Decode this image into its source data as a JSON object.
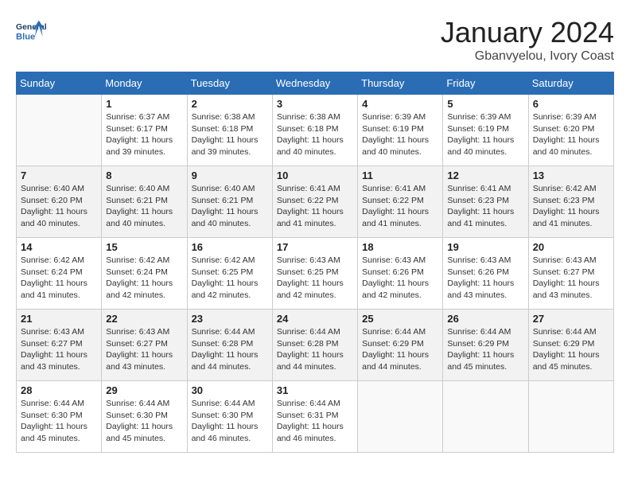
{
  "header": {
    "logo_line1": "General",
    "logo_line2": "Blue",
    "month": "January 2024",
    "location": "Gbanvyelou, Ivory Coast"
  },
  "days_of_week": [
    "Sunday",
    "Monday",
    "Tuesday",
    "Wednesday",
    "Thursday",
    "Friday",
    "Saturday"
  ],
  "weeks": [
    [
      {
        "day": "",
        "info": ""
      },
      {
        "day": "1",
        "info": "Sunrise: 6:37 AM\nSunset: 6:17 PM\nDaylight: 11 hours\nand 39 minutes."
      },
      {
        "day": "2",
        "info": "Sunrise: 6:38 AM\nSunset: 6:18 PM\nDaylight: 11 hours\nand 39 minutes."
      },
      {
        "day": "3",
        "info": "Sunrise: 6:38 AM\nSunset: 6:18 PM\nDaylight: 11 hours\nand 40 minutes."
      },
      {
        "day": "4",
        "info": "Sunrise: 6:39 AM\nSunset: 6:19 PM\nDaylight: 11 hours\nand 40 minutes."
      },
      {
        "day": "5",
        "info": "Sunrise: 6:39 AM\nSunset: 6:19 PM\nDaylight: 11 hours\nand 40 minutes."
      },
      {
        "day": "6",
        "info": "Sunrise: 6:39 AM\nSunset: 6:20 PM\nDaylight: 11 hours\nand 40 minutes."
      }
    ],
    [
      {
        "day": "7",
        "info": "Sunrise: 6:40 AM\nSunset: 6:20 PM\nDaylight: 11 hours\nand 40 minutes."
      },
      {
        "day": "8",
        "info": "Sunrise: 6:40 AM\nSunset: 6:21 PM\nDaylight: 11 hours\nand 40 minutes."
      },
      {
        "day": "9",
        "info": "Sunrise: 6:40 AM\nSunset: 6:21 PM\nDaylight: 11 hours\nand 40 minutes."
      },
      {
        "day": "10",
        "info": "Sunrise: 6:41 AM\nSunset: 6:22 PM\nDaylight: 11 hours\nand 41 minutes."
      },
      {
        "day": "11",
        "info": "Sunrise: 6:41 AM\nSunset: 6:22 PM\nDaylight: 11 hours\nand 41 minutes."
      },
      {
        "day": "12",
        "info": "Sunrise: 6:41 AM\nSunset: 6:23 PM\nDaylight: 11 hours\nand 41 minutes."
      },
      {
        "day": "13",
        "info": "Sunrise: 6:42 AM\nSunset: 6:23 PM\nDaylight: 11 hours\nand 41 minutes."
      }
    ],
    [
      {
        "day": "14",
        "info": "Sunrise: 6:42 AM\nSunset: 6:24 PM\nDaylight: 11 hours\nand 41 minutes."
      },
      {
        "day": "15",
        "info": "Sunrise: 6:42 AM\nSunset: 6:24 PM\nDaylight: 11 hours\nand 42 minutes."
      },
      {
        "day": "16",
        "info": "Sunrise: 6:42 AM\nSunset: 6:25 PM\nDaylight: 11 hours\nand 42 minutes."
      },
      {
        "day": "17",
        "info": "Sunrise: 6:43 AM\nSunset: 6:25 PM\nDaylight: 11 hours\nand 42 minutes."
      },
      {
        "day": "18",
        "info": "Sunrise: 6:43 AM\nSunset: 6:26 PM\nDaylight: 11 hours\nand 42 minutes."
      },
      {
        "day": "19",
        "info": "Sunrise: 6:43 AM\nSunset: 6:26 PM\nDaylight: 11 hours\nand 43 minutes."
      },
      {
        "day": "20",
        "info": "Sunrise: 6:43 AM\nSunset: 6:27 PM\nDaylight: 11 hours\nand 43 minutes."
      }
    ],
    [
      {
        "day": "21",
        "info": "Sunrise: 6:43 AM\nSunset: 6:27 PM\nDaylight: 11 hours\nand 43 minutes."
      },
      {
        "day": "22",
        "info": "Sunrise: 6:43 AM\nSunset: 6:27 PM\nDaylight: 11 hours\nand 43 minutes."
      },
      {
        "day": "23",
        "info": "Sunrise: 6:44 AM\nSunset: 6:28 PM\nDaylight: 11 hours\nand 44 minutes."
      },
      {
        "day": "24",
        "info": "Sunrise: 6:44 AM\nSunset: 6:28 PM\nDaylight: 11 hours\nand 44 minutes."
      },
      {
        "day": "25",
        "info": "Sunrise: 6:44 AM\nSunset: 6:29 PM\nDaylight: 11 hours\nand 44 minutes."
      },
      {
        "day": "26",
        "info": "Sunrise: 6:44 AM\nSunset: 6:29 PM\nDaylight: 11 hours\nand 45 minutes."
      },
      {
        "day": "27",
        "info": "Sunrise: 6:44 AM\nSunset: 6:29 PM\nDaylight: 11 hours\nand 45 minutes."
      }
    ],
    [
      {
        "day": "28",
        "info": "Sunrise: 6:44 AM\nSunset: 6:30 PM\nDaylight: 11 hours\nand 45 minutes."
      },
      {
        "day": "29",
        "info": "Sunrise: 6:44 AM\nSunset: 6:30 PM\nDaylight: 11 hours\nand 45 minutes."
      },
      {
        "day": "30",
        "info": "Sunrise: 6:44 AM\nSunset: 6:30 PM\nDaylight: 11 hours\nand 46 minutes."
      },
      {
        "day": "31",
        "info": "Sunrise: 6:44 AM\nSunset: 6:31 PM\nDaylight: 11 hours\nand 46 minutes."
      },
      {
        "day": "",
        "info": ""
      },
      {
        "day": "",
        "info": ""
      },
      {
        "day": "",
        "info": ""
      }
    ]
  ]
}
